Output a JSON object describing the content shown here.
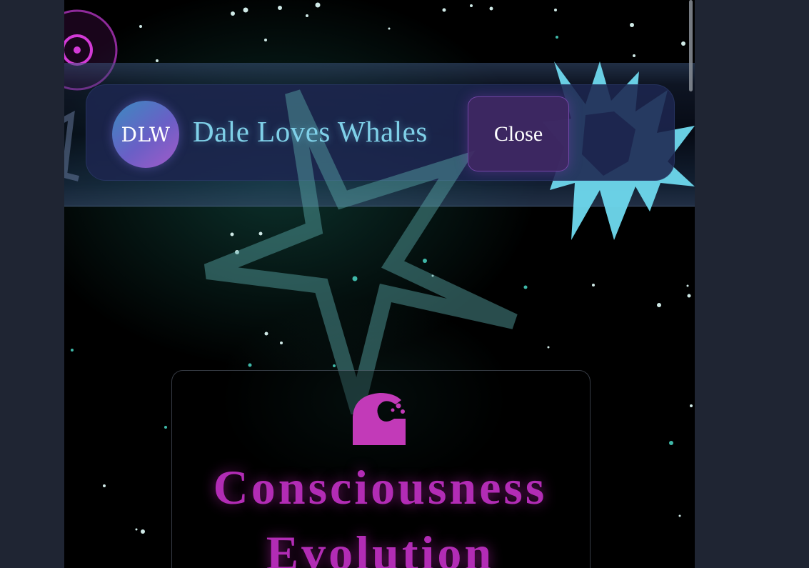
{
  "header": {
    "logo_initials": "DLW",
    "brand_title": "Dale Loves Whales",
    "close_label": "Close"
  },
  "card": {
    "title_line1": "Consciousness",
    "title_line2": "Evolution",
    "icon": "wave-icon"
  },
  "decor": {
    "orb_icon": "target-orb-icon",
    "star_icon": "star-outline-icon",
    "spike_icon": "spiky-star-icon"
  },
  "colors": {
    "accent_teal": "#7fd0e8",
    "accent_magenta": "#b22cb5",
    "header_bg": "#1c264e",
    "page_bg": "#000000",
    "outer_bg": "#1f2533"
  }
}
